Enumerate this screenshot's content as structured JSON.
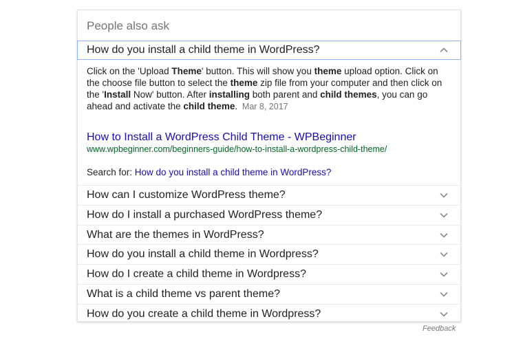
{
  "panel": {
    "heading": "People also ask",
    "open_question": "How do you install a child theme in WordPress?",
    "answer": {
      "segments": [
        {
          "t": "Click on the 'Upload ",
          "b": false
        },
        {
          "t": "Theme",
          "b": true
        },
        {
          "t": "' button. This will show you ",
          "b": false
        },
        {
          "t": "theme",
          "b": true
        },
        {
          "t": " upload option. Click on the choose file button to select the ",
          "b": false
        },
        {
          "t": "theme",
          "b": true
        },
        {
          "t": " zip file from your computer and then click on the '",
          "b": false
        },
        {
          "t": "Install",
          "b": true
        },
        {
          "t": " Now' button. After ",
          "b": false
        },
        {
          "t": "installing",
          "b": true
        },
        {
          "t": " both parent and ",
          "b": false
        },
        {
          "t": "child themes",
          "b": true
        },
        {
          "t": ", you can go ahead and activate the ",
          "b": false
        },
        {
          "t": "child theme",
          "b": true
        },
        {
          "t": ".",
          "b": false
        }
      ],
      "date": "Mar 8, 2017"
    },
    "source_title": "How to Install a WordPress Child Theme - WPBeginner",
    "source_url": "www.wpbeginner.com/beginners-guide/how-to-install-a-wordpress-child-theme/",
    "search_for_label": "Search for:",
    "search_for_query": "How do you install a child theme in WordPress?",
    "questions": [
      "How can I customize WordPress theme?",
      "How do I install a purchased WordPress theme?",
      "What are the themes in WordPress?",
      "How do you install a child theme in Wordpress?",
      "How do I create a child theme in Wordpress?",
      "What is a child theme vs parent theme?",
      "How do you create a child theme in Wordpress?"
    ],
    "chevron_icon_open": "chevron-up-icon",
    "chevron_icon_closed": "chevron-down-icon"
  },
  "feedback_label": "Feedback",
  "colors": {
    "link": "#1a0dab",
    "url": "#006621",
    "focus_border": "#8ab4f8",
    "muted": "#757575"
  }
}
